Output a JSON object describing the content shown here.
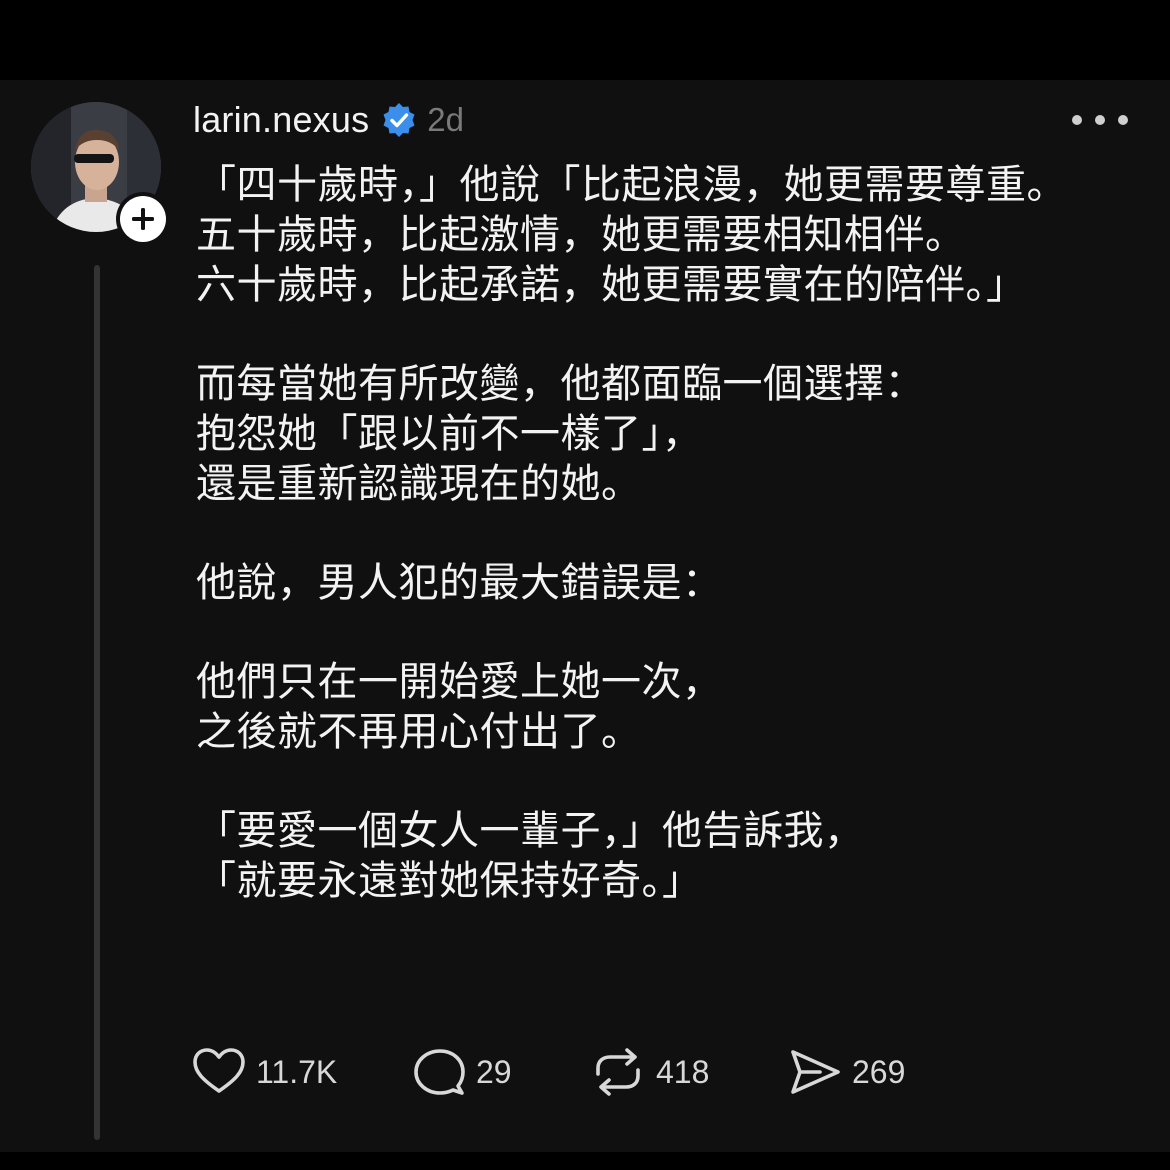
{
  "post": {
    "username": "larin.nexus",
    "time": "2d",
    "lines": [
      "「四十歲時，」他說「比起浪漫，她更需要尊重。",
      "五十歲時，比起激情，她更需要相知相伴。",
      "六十歲時，比起承諾，她更需要實在的陪伴。」",
      "",
      "而每當她有所改變，他都面臨一個選擇：",
      "抱怨她「跟以前不一樣了」，",
      "還是重新認識現在的她。",
      "",
      "他說，男人犯的最大錯誤是：",
      "",
      "他們只在一開始愛上她一次，",
      "之後就不再用心付出了。",
      "",
      "「要愛一個女人一輩子，」他告訴我，",
      "「就要永遠對她保持好奇。」"
    ]
  },
  "actions": {
    "likes": "11.7K",
    "replies": "29",
    "reposts": "418",
    "shares": "269"
  },
  "icons": {
    "verified": "verified-badge-icon",
    "follow": "plus-icon",
    "more": "more-dots-icon",
    "like": "heart-icon",
    "reply": "comment-icon",
    "repost": "repost-icon",
    "share": "send-icon"
  },
  "colors": {
    "background": "#101010",
    "text": "#f3f3f3",
    "secondary": "#7a7a7a",
    "verified": "#3b8eea"
  }
}
